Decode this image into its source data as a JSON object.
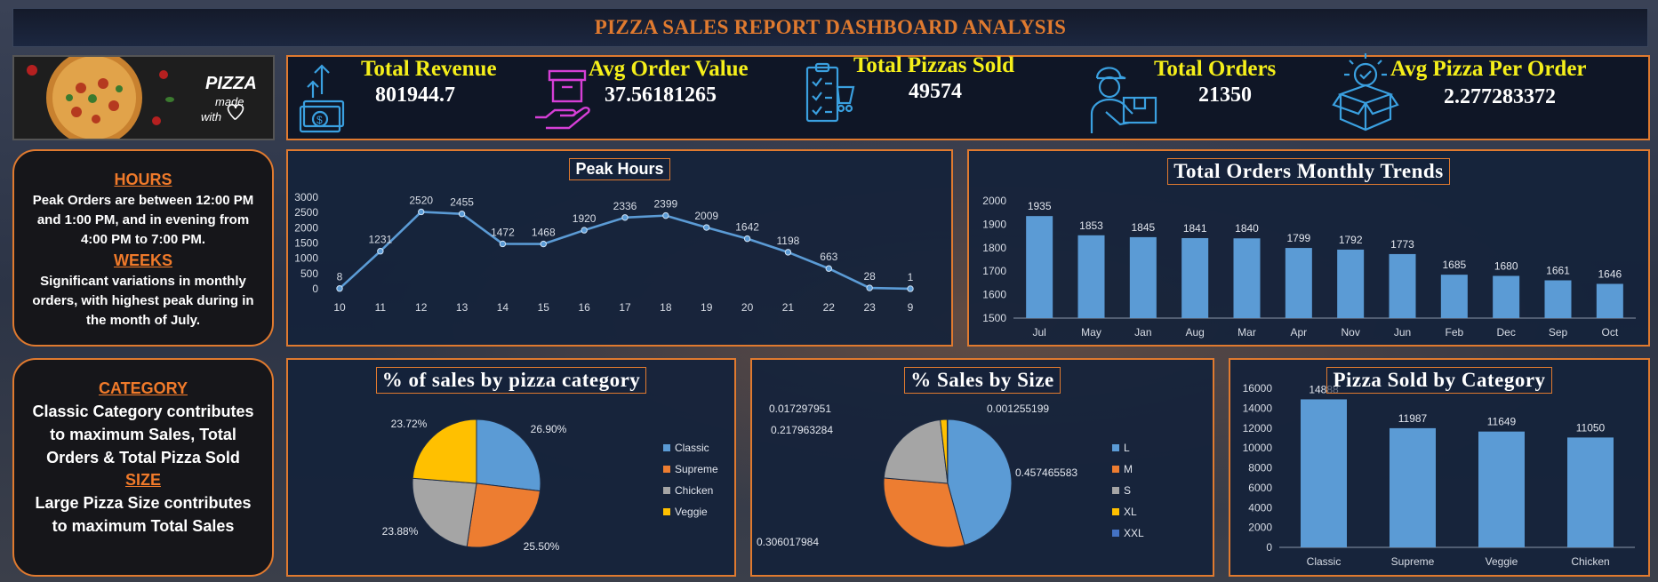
{
  "title": "PIZZA SALES REPORT DASHBOARD ANALYSIS",
  "logo": {
    "line1": "PIZZA",
    "line2": "made",
    "line3": "with",
    "icon": "heart-icon"
  },
  "kpis": [
    {
      "title": "Total Revenue",
      "value": "801944.7",
      "icon": "money-growth-icon",
      "color": "#3aa0e0"
    },
    {
      "title": "Avg Order Value",
      "value": "37.56181265",
      "icon": "hand-box-icon",
      "color": "#d63fd6"
    },
    {
      "title": "Total Pizzas Sold",
      "value": "49574",
      "icon": "checklist-icon",
      "color": "#3aa0e0"
    },
    {
      "title": "Total Orders",
      "value": "21350",
      "icon": "delivery-man-icon",
      "color": "#3aa0e0"
    },
    {
      "title": "Avg Pizza Per Order",
      "value": "2.277283372",
      "icon": "open-box-check-icon",
      "color": "#3aa0e0"
    }
  ],
  "notes": {
    "hours_heading": "HOURS",
    "hours_text": "Peak Orders are between 12:00 PM and 1:00 PM, and in evening from 4:00 PM to 7:00 PM.",
    "weeks_heading": "WEEKS",
    "weeks_text": "Significant variations in monthly orders, with highest peak during in the month of July.",
    "category_heading": "CATEGORY",
    "category_text": "Classic Category contributes to maximum Sales, Total Orders & Total Pizza Sold",
    "size_heading": "SIZE",
    "size_text": "Large Pizza Size contributes to maximum Total Sales"
  },
  "colors": {
    "accent": "#e07a2f",
    "kpi_title": "#f5ef1a",
    "series": "#5b9bd5"
  },
  "chart_data": [
    {
      "type": "line",
      "title": "Peak Hours",
      "x": [
        "10",
        "11",
        "12",
        "13",
        "14",
        "15",
        "16",
        "17",
        "18",
        "19",
        "20",
        "21",
        "22",
        "23",
        "9"
      ],
      "values": [
        8,
        1231,
        2520,
        2455,
        1472,
        1468,
        1920,
        2336,
        2399,
        2009,
        1642,
        1198,
        663,
        28,
        1
      ],
      "yticks": [
        "0",
        "500",
        "1000",
        "1500",
        "2000",
        "2500",
        "3000"
      ],
      "ylim": [
        0,
        3000
      ],
      "grid": false
    },
    {
      "type": "bar",
      "title": "Total Orders Monthly Trends",
      "categories": [
        "Jul",
        "May",
        "Jan",
        "Aug",
        "Mar",
        "Apr",
        "Nov",
        "Jun",
        "Feb",
        "Dec",
        "Sep",
        "Oct"
      ],
      "values": [
        1935,
        1853,
        1845,
        1841,
        1840,
        1799,
        1792,
        1773,
        1685,
        1680,
        1661,
        1646
      ],
      "yticks": [
        "1500",
        "1600",
        "1700",
        "1800",
        "1900",
        "2000"
      ],
      "ylim": [
        1500,
        2000
      ],
      "grid": false
    },
    {
      "type": "pie",
      "title": "% of sales by pizza category",
      "categories": [
        "Classic",
        "Supreme",
        "Chicken",
        "Veggie"
      ],
      "values": [
        26.9,
        25.5,
        23.88,
        23.72
      ],
      "labels": [
        "26.90%",
        "25.50%",
        "23.88%",
        "23.72%"
      ],
      "colors": [
        "#5b9bd5",
        "#ed7d31",
        "#a5a5a5",
        "#ffc000"
      ],
      "legend": "right"
    },
    {
      "type": "pie",
      "title": "% Sales by Size",
      "categories": [
        "L",
        "M",
        "S",
        "XL",
        "XXL"
      ],
      "values": [
        0.457465583,
        0.306017984,
        0.217963284,
        0.017297951,
        0.001255199
      ],
      "labels": [
        "0.457465583",
        "0.306017984",
        "0.217963284",
        "0.017297951",
        "0.001255199"
      ],
      "colors": [
        "#5b9bd5",
        "#ed7d31",
        "#a5a5a5",
        "#ffc000",
        "#4472c4"
      ],
      "legend": "right"
    },
    {
      "type": "bar",
      "title": "Pizza Sold by Category",
      "categories": [
        "Classic",
        "Supreme",
        "Veggie",
        "Chicken"
      ],
      "values": [
        14888,
        11987,
        11649,
        11050
      ],
      "yticks": [
        "0",
        "2000",
        "4000",
        "6000",
        "8000",
        "10000",
        "12000",
        "14000",
        "16000"
      ],
      "ylim": [
        0,
        16000
      ],
      "grid": false
    }
  ]
}
